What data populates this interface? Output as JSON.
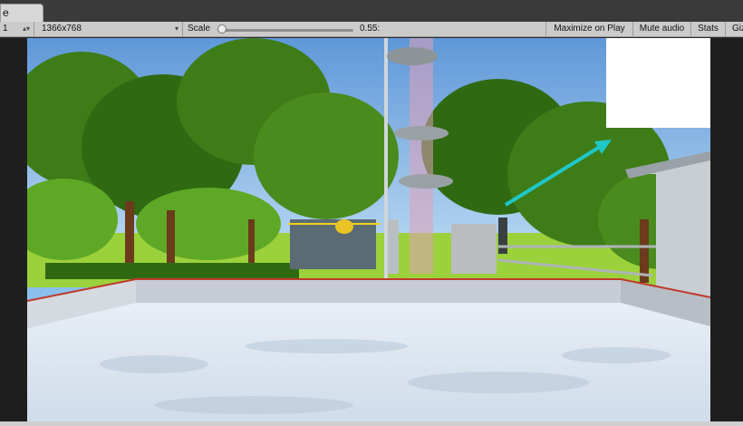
{
  "window": {
    "tab_label": "e"
  },
  "toolbar": {
    "display": "1",
    "resolution": "1366x768",
    "scale_label": "Scale",
    "scale_value": "0.55:",
    "maximize_on_play": "Maximize on Play",
    "mute_audio": "Mute audio",
    "stats": "Stats",
    "gizmos": "Giz"
  },
  "icons": {
    "display_arrow": "updown-arrow-icon",
    "resolution_arrow": "dropdown-arrow-icon"
  },
  "colors": {
    "toolbar_bg": "#cbcbcb",
    "sky": "#8bc0ec",
    "tree_dark": "#2f6a12",
    "tree_light": "#5fa826",
    "grass": "#9bd13b",
    "pool_wall": "#c8ccd4",
    "pool_floor": "#dde7f2",
    "pool_edge": "#c0392b",
    "arrow": "#1fc7c7",
    "railing": "#f2d21b"
  }
}
